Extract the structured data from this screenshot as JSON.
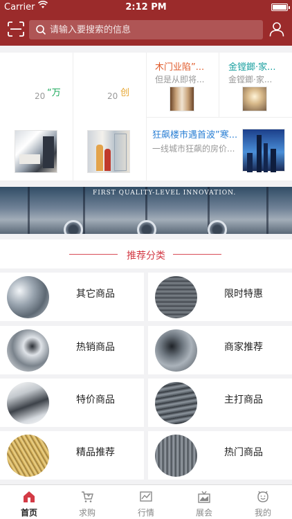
{
  "status_bar": {
    "carrier": "Carrier",
    "time": "2:12 PM"
  },
  "search": {
    "placeholder": "请输入要搜索的信息"
  },
  "news": {
    "marquee": [
      {
        "year": "20",
        "quote": "“万",
        "color": "#1aa85a"
      },
      {
        "year": "20",
        "quote": "创",
        "color": "#e6a52e"
      }
    ],
    "items": [
      {
        "title": "木门业陷”...",
        "subtitle": "但是从即将...",
        "color": "#e05a2a"
      },
      {
        "title": "金镗鎯·家...",
        "subtitle": "金镗鎯·家...",
        "color": "#1aa0a0"
      },
      {
        "title": "狂飙楼市遇首波”寒...",
        "subtitle": "一线城市狂飙的房价...",
        "color": "#2a7fd4"
      }
    ]
  },
  "banner": {
    "caption": "FIRST QUALITY-LEVEL INNOVATION."
  },
  "section": {
    "title": "推荐分类"
  },
  "categories": [
    {
      "label": "其它商品",
      "icon": "pipe-bundle"
    },
    {
      "label": "限时特惠",
      "icon": "rebar-coil"
    },
    {
      "label": "热销商品",
      "icon": "pipe-stack"
    },
    {
      "label": "商家推荐",
      "icon": "pipe-pile"
    },
    {
      "label": "特价商品",
      "icon": "steel-tubes"
    },
    {
      "label": "主打商品",
      "icon": "steel-bars"
    },
    {
      "label": "精品推荐",
      "icon": "threaded-rods"
    },
    {
      "label": "热门商品",
      "icon": "rebar-bundle"
    }
  ],
  "tabbar": [
    {
      "label": "首页",
      "icon": "home-icon",
      "active": true
    },
    {
      "label": "求购",
      "icon": "cart-icon",
      "active": false
    },
    {
      "label": "行情",
      "icon": "chart-icon",
      "active": false
    },
    {
      "label": "展会",
      "icon": "exhibition-icon",
      "active": false
    },
    {
      "label": "我的",
      "icon": "profile-icon",
      "active": false
    }
  ],
  "colors": {
    "header": "#9b2b2b",
    "accent": "#d33a45"
  }
}
